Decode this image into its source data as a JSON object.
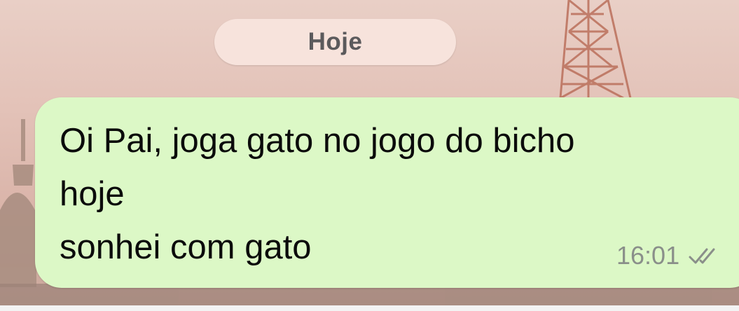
{
  "chat": {
    "date_separator": "Hoje",
    "message": {
      "lines": [
        "Oi Pai, joga gato no jogo do bicho",
        "hoje",
        "sonhei com gato"
      ],
      "time": "16:01",
      "status_icon": "double-check-icon"
    }
  },
  "colors": {
    "bubble_background": "#dcf8c6",
    "date_chip_background": "#f7e3dc",
    "time_text": "#8a8f8a"
  }
}
